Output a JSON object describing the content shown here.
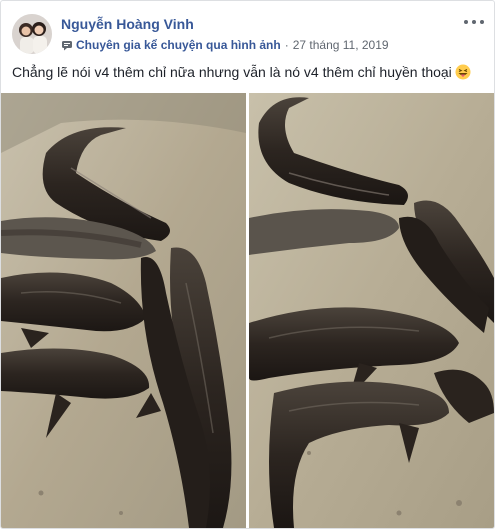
{
  "post": {
    "author": "Nguyễn Hoàng Vinh",
    "badge_label": "Chuyên gia kể chuyện qua hình ảnh",
    "separator": "·",
    "timestamp": "27 tháng 11, 2019",
    "caption": "Chẳng lẽ nói v4 thêm chỉ nữa nhưng vẫn là nó v4 thêm chỉ huyền thoại",
    "caption_emoji": "grinning-squint-tongue-emoji",
    "badge_icon": "storyteller-badge-icon",
    "more_icon": "more-options-icon"
  },
  "photos": [
    {
      "subject": "snakehead-fish-left-photo"
    },
    {
      "subject": "snakehead-fish-right-photo"
    }
  ],
  "colors": {
    "author": "#385898",
    "meta": "#606770",
    "text": "#1d2129",
    "border": "#dddfe2",
    "ground": "#b8ad96",
    "fish": "#2e2823"
  }
}
